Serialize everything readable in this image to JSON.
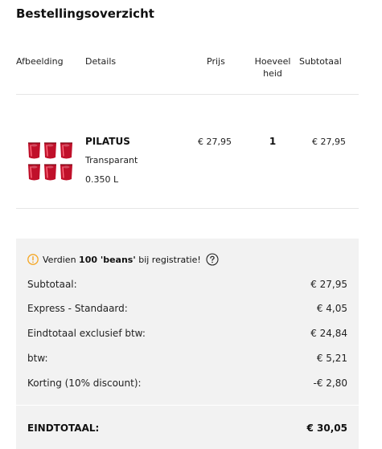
{
  "page_title": "Bestellingsoverzicht",
  "table": {
    "headers": {
      "image": "Afbeelding",
      "details": "Details",
      "price": "Prijs",
      "quantity_line1": "Hoeveel",
      "quantity_line2": "heid",
      "subtotal": "Subtotaal"
    },
    "rows": [
      {
        "image_icon": "glasses-set-icon",
        "name": "PILATUS",
        "color": "Transparant",
        "size": "0.350 L",
        "price": "€ 27,95",
        "quantity": "1",
        "subtotal": "€ 27,95"
      }
    ]
  },
  "summary": {
    "promo": {
      "icon": "info-circle-icon",
      "prefix": "Verdien ",
      "highlight": "100 'beans'",
      "suffix": " bij registratie!",
      "help_icon": "question-circle-icon"
    },
    "lines": [
      {
        "label": "Subtotaal:",
        "value": "€ 27,95"
      },
      {
        "label": "Express - Standaard:",
        "value": "€ 4,05"
      },
      {
        "label": "Eindtotaal exclusief btw:",
        "value": "€ 24,84"
      },
      {
        "label": "btw:",
        "value": "€ 5,21"
      },
      {
        "label": "Korting (10% discount):",
        "value": "-€ 2,80"
      }
    ],
    "total": {
      "label": "EINDTOTAAL:",
      "value": "€ 30,05"
    }
  },
  "colors": {
    "summary_background": "#f2f2f2",
    "promo_icon": "#f5a623",
    "glass_red": "#c0102a"
  }
}
